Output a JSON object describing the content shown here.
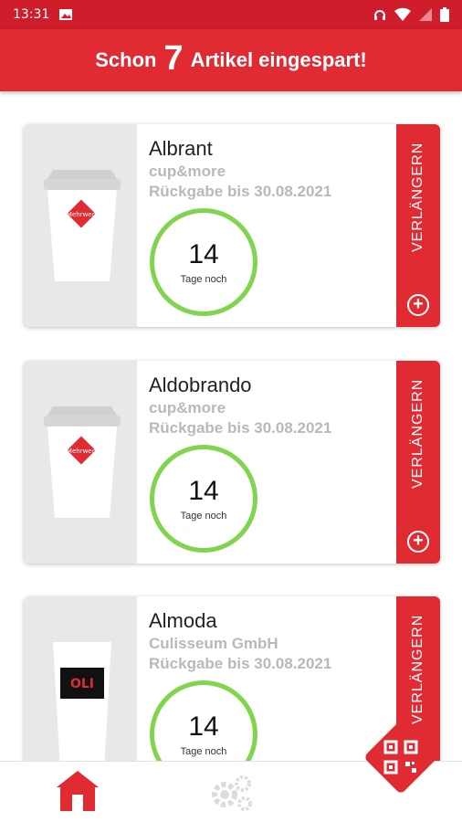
{
  "status_bar": {
    "time": "13:31",
    "icons": [
      "gallery-icon",
      "headset-icon",
      "wifi-icon",
      "battery-icon"
    ]
  },
  "header": {
    "prefix": "Schon",
    "count": "7",
    "suffix": "Artikel eingespart!"
  },
  "colors": {
    "primary": "#e12b33",
    "status_bar": "#cf1d2b",
    "ring": "#7fd54b",
    "muted_text": "#b9b9b9"
  },
  "items": [
    {
      "name": "Albrant",
      "vendor": "cup&more",
      "return_text": "Rückgabe bis 30.08.2021",
      "days": "14",
      "days_label": "Tage noch",
      "extend_label": "VERLÄNGERN",
      "cup_logo": "mehrweg"
    },
    {
      "name": "Aldobrando",
      "vendor": "cup&more",
      "return_text": "Rückgabe bis 30.08.2021",
      "days": "14",
      "days_label": "Tage noch",
      "extend_label": "VERLÄNGERN",
      "cup_logo": "mehrweg"
    },
    {
      "name": "Almoda",
      "vendor": "Culisseum GmbH",
      "return_text": "Rückgabe bis 30.08.2021",
      "days": "14",
      "days_label": "Tage noch",
      "extend_label": "VERLÄNGERN",
      "cup_logo": "oli"
    }
  ],
  "bottom_nav": {
    "home_icon": "home-icon",
    "settings_icon": "gears-icon",
    "fab_icon": "qr-code-icon"
  }
}
